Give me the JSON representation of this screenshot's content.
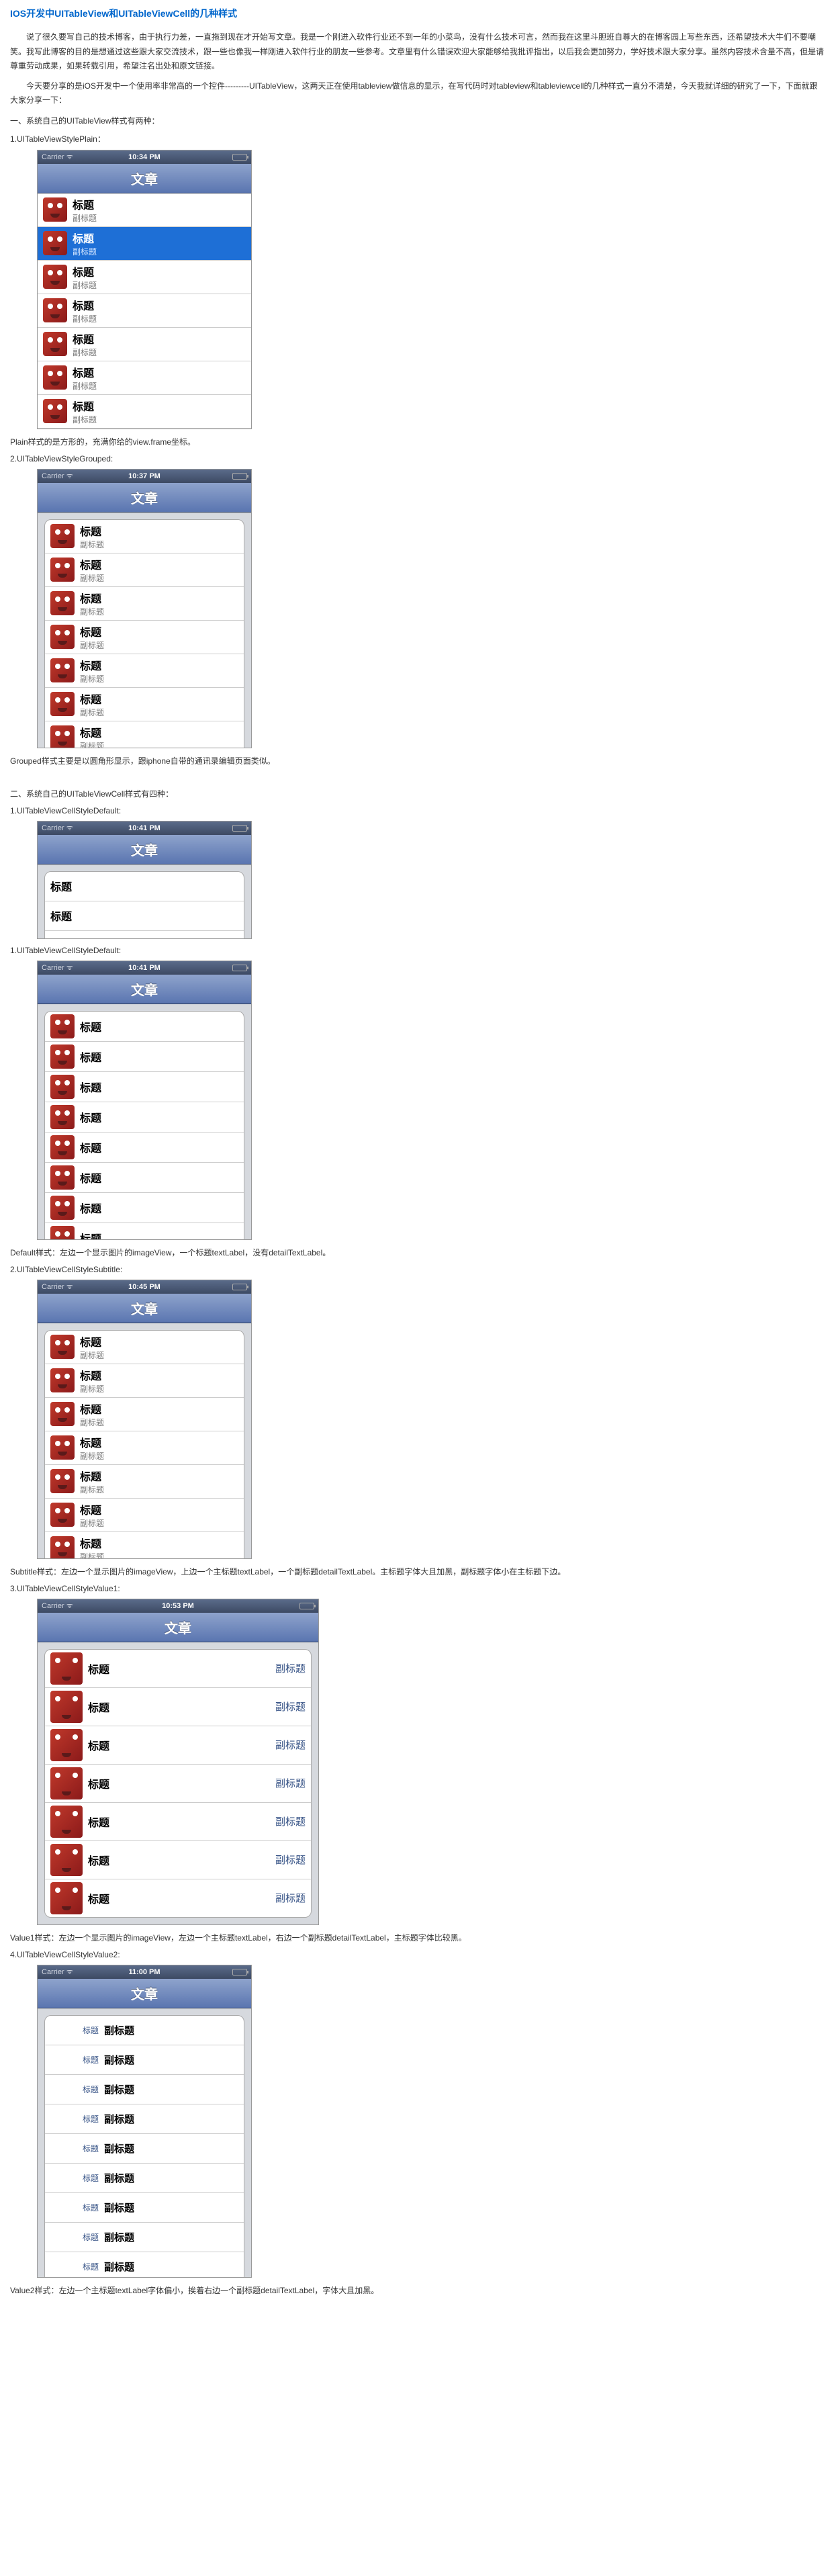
{
  "title": "IOS开发中UITableView和UITableViewCell的几种样式",
  "intro_p1": "说了很久要写自己的技术博客，由于执行力差，一直拖到现在才开始写文章。我是一个刚进入软件行业还不到一年的小菜鸟，没有什么技术可言，然而我在这里斗胆班自尊大的在博客园上写些东西，还希望技术大牛们不要嘲笑。我写此博客的目的是想通过这些跟大家交流技术，跟一些也像我一样刚进入软件行业的朋友一些参考。文章里有什么错误欢迎大家能够给我批评指出，以后我会更加努力，学好技术跟大家分享。虽然内容技术含量不高，但是请尊重劳动成果，如果转载引用，希望注名出处和原文链接。",
  "intro_p2": "今天要分享的是iOS开发中一个使用率非常高的一个控件---------UITableView，这两天正在使用tableview做信息的显示，在写代码时对tableview和tableviewcell的几种样式一直分不清楚，今天我就详细的研究了一下，下面就跟大家分享一下：",
  "sec1_title": "一、系统自己的UITableView样式有两种：",
  "s1_label": "1.UITableViewStylePlain：",
  "plain_desc": "Plain样式的是方形的，充满你给的view.frame坐标。",
  "s2_label": "2.UITableViewStyleGrouped:",
  "grouped_desc": "Grouped样式主要是以圆角形显示，跟iphone自带的通讯录编辑页面类似。",
  "sec2_title": "二、系统自己的UITableViewCell样式有四种：",
  "c1_label": "1.UITableViewCellStyleDefault:",
  "c1b_label": "1.UITableViewCellStyleDefault:",
  "default_desc": "Default样式：左边一个显示图片的imageView，一个标题textLabel，没有detailTextLabel。",
  "c2_label": "2.UITableViewCellStyleSubtitle:",
  "subtitle_desc": "Subtitle样式：左边一个显示图片的imageView，上边一个主标题textLabel，一个副标题detailTextLabel。主标题字体大且加黑，副标题字体小在主标题下边。",
  "c3_label": "3.UITableViewCellStyleValue1:",
  "value1_desc": "Value1样式：左边一个显示图片的imageView，左边一个主标题textLabel，右边一个副标题detailTextLabel，主标题字体比较黑。",
  "c4_label": "4.UITableViewCellStyleValue2:",
  "value2_desc": "Value2样式：左边一个主标题textLabel字体偏小，挨着右边一个副标题detailTextLabel，字体大且加黑。",
  "nav_title": "文章",
  "carrier": "Carrier",
  "wifi": "ᯤ",
  "main_label": "标题",
  "sub_label": "副标题",
  "times": {
    "p1": "10:34 PM",
    "p2": "10:37 PM",
    "p3": "10:41 PM",
    "p4": "10:41 PM",
    "p5": "10:45 PM",
    "p6": "10:53 PM",
    "p7": "11:00 PM"
  }
}
